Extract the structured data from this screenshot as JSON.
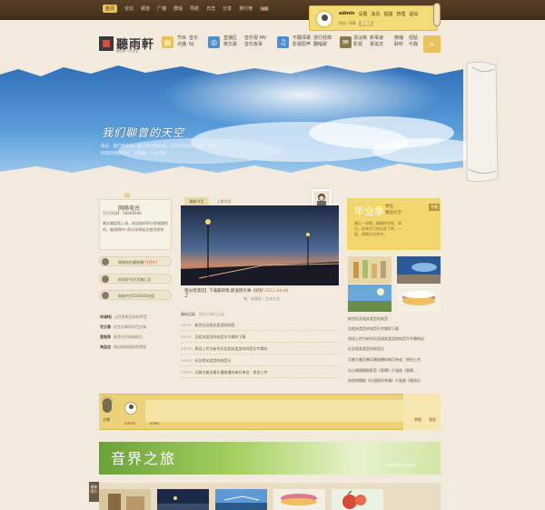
{
  "topbar": {
    "nav": [
      "首页",
      "论坛",
      "频道",
      "广播",
      "群组",
      "导航",
      "日志",
      "分享",
      "排行榜"
    ],
    "badge": "+6"
  },
  "user": {
    "name": "admin",
    "links": [
      "设置",
      "消息",
      "提醒",
      "管理",
      "退出"
    ],
    "points_label": "积分: 198",
    "group_label": "管理员"
  },
  "logo": {
    "title": "聽雨軒",
    "subtitle": "我们的一片天空"
  },
  "header_nav": [
    {
      "icon": "document-icon",
      "lines": [
        "节目",
        "点播"
      ]
    },
    {
      "icon": "headphones-icon",
      "lines": [
        "音乐",
        "NJ"
      ]
    },
    {
      "icon": "music-note-icon",
      "lines": [
        "直播区",
        "英文歌"
      ],
      "lines2": [
        "音乐视 MV",
        "音乐故事"
      ]
    },
    {
      "icon": "music-note-icon",
      "lines": [
        "不翻译歌",
        "影视原声"
      ],
      "lines2": [
        "流行经典",
        "翻唱歌"
      ]
    },
    {
      "icon": "chat-icon",
      "lines": [
        "聊聊",
        "谈心"
      ],
      "lines2": [
        "故事连",
        "载"
      ]
    }
  ],
  "header_nav_extra": {
    "lines": [
      "清淡斋",
      "影视",
      "我发帖"
    ],
    "lines2": [
      "新事速",
      "报说法"
    ],
    "lines3": [
      "微缩",
      "聆听"
    ],
    "lines4": [
      "招贴",
      "与我"
    ]
  },
  "banner": {
    "title": "我们聊曾的天空",
    "line1": "每天，我们聆听的，是十年出发的你，日子的风景的心路，让阳光",
    "line2": "听雨轩网络电台，只因唯一一起完美"
  },
  "left": {
    "radio_title": "网络电台",
    "radio_addr": "官方QQ群：88888888",
    "radio_desc": "阖文编程版上线，欢迎收听积分香城路的的。敬请期待!(积分场等级及使用规则",
    "pills": [
      {
        "text": "网络电台最新播",
        "hot": "(节目中)"
      },
      {
        "text": "听雨轩节目文稿汇总"
      },
      {
        "text": "网络节目CD/DVD光盘"
      }
    ],
    "links": [
      {
        "k": "申请NJ",
        "v": "让世界听见你的声音"
      },
      {
        "k": "写文章",
        "v": "优秀文章同节目文稿"
      },
      {
        "k": "爱推荐",
        "v": "推荐节目网络网页"
      },
      {
        "k": "淘宝店",
        "v": "周边网络版权免费版"
      }
    ]
  },
  "middle": {
    "tabs": [
      "最新节目",
      "上期节目"
    ],
    "caption": "我似曾遇见】下满最新情,那准明天事《好好",
    "caption_date": "2012-08-06",
    "sub": "NJ：听雨轩   -   文本大全",
    "tabs2": [
      "最新回复",
      "用的文章归之展"
    ],
    "rows": [
      {
        "who": "admin",
        "text": "新世纪及相关类型的纯音"
      },
      {
        "who": "admin",
        "text": "及相关类型的纯音乐专辑的下载"
      },
      {
        "who": "admin",
        "text": "原创上传为新世纪及相关类型的纯音乐专辑的"
      },
      {
        "who": "admin",
        "text": "纪及相关类型的纯音乐"
      },
      {
        "who": "admin",
        "text": "月着为着贡酱乐播放播的每月单会：原创上传"
      }
    ]
  },
  "right": {
    "grad_title": "毕业季",
    "grad_sub": [
      "青拉",
      "我的大学"
    ],
    "grad_desc": "最后一学期，慢慢的学校，然后，说来学习纷出发了的，一起，请和毕业季中。",
    "grad_tag": "专题",
    "rows": [
      "新世纪及相关类型的纯音",
      "及相关类型的纯音乐专辑的下载",
      "原创上传为新世纪及相关类型的纯音乐专辑的纪",
      "纪及相关类型的纯音乐",
      "月着为着贡酱乐播放播的每月单会：原创上传",
      "本山唱情播歌影音《冒牌》片尾曲《冒牌...",
      "央视热播剧《分道扬的幸福》片尾曲《曾经幻"
    ]
  },
  "player": {
    "host_label": "主播",
    "avatars": [
      "admin",
      "vnlkc"
    ],
    "right_labels": [
      "举报",
      "我发"
    ]
  },
  "world": {
    "title": "音界之旅",
    "site": "TingYuXuan.Net"
  },
  "bottom": {
    "tab": "最新图片"
  },
  "colors": {
    "accent": "#e8c25a",
    "wood": "#4a3420",
    "paper": "#f2ebdd"
  }
}
